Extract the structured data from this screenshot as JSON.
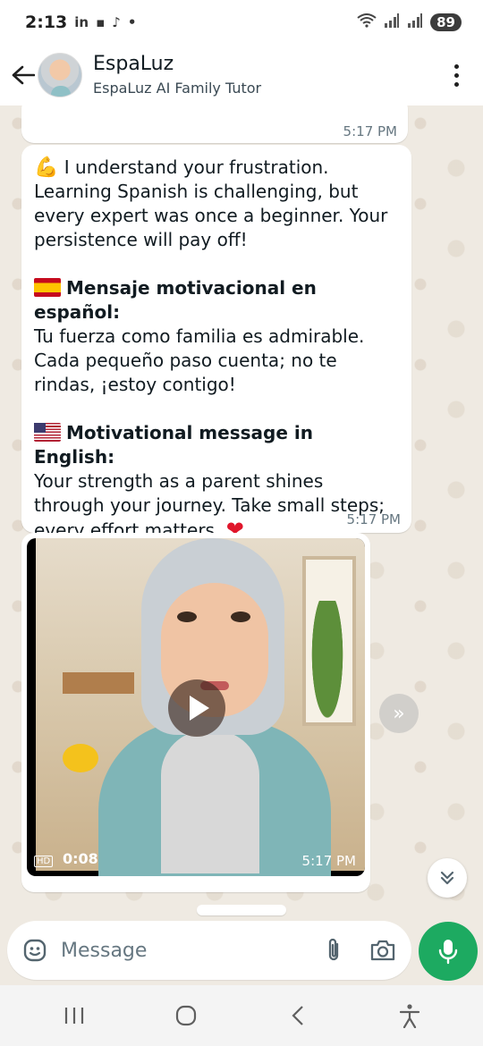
{
  "status_bar": {
    "time": "2:13",
    "notif_icons": [
      "linkedin-icon",
      "tiktok-icon"
    ],
    "dot": "•",
    "battery": "89"
  },
  "header": {
    "contact_name": "EspaLuz",
    "contact_subtitle": "EspaLuz AI Family Tutor"
  },
  "messages": [
    {
      "type": "text",
      "time": "5:17 PM"
    },
    {
      "type": "text",
      "intro_line1": "I understand your frustration.",
      "intro_rest": "Learning Spanish is challenging, but every expert was once a beginner. Your persistence will pay off!",
      "es_heading": "Mensaje motivacional en español:",
      "es_body": "Tu fuerza como familia es admirable. Cada pequeño paso cuenta; no te rindas, ¡estoy contigo!",
      "en_heading": "Motivational message in English:",
      "en_body": "Your strength as a parent shines through your journey. Take small steps; every effort matters.",
      "time": "5:17 PM"
    },
    {
      "type": "video",
      "quality": "HD",
      "duration": "0:08",
      "time": "5:17 PM"
    }
  ],
  "input": {
    "placeholder": "Message"
  },
  "colors": {
    "chat_bg": "#efeae2",
    "bubble": "#ffffff",
    "mic_green": "#1daa61",
    "timestamp": "#667781"
  }
}
